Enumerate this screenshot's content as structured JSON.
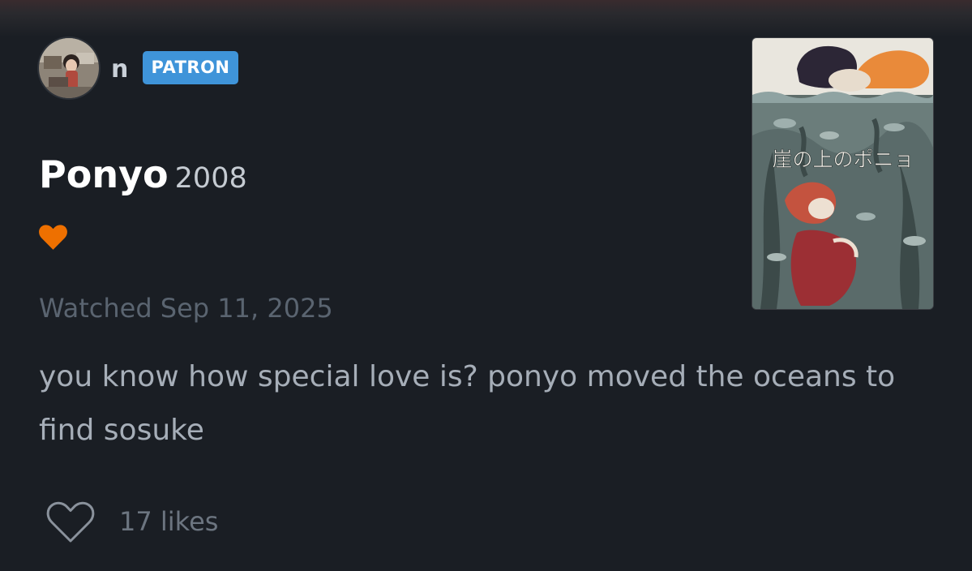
{
  "user": {
    "name": "n",
    "badge": "PATRON",
    "avatar": "user-avatar-photo"
  },
  "film": {
    "title": "Ponyo",
    "year": "2008",
    "poster": "ponyo-poster",
    "poster_text": "崖の上のポニョ"
  },
  "review": {
    "liked": true,
    "like_icon": "heart-filled-icon",
    "like_color": "#ee7000",
    "watched_date": "Watched Sep 11, 2025",
    "body": "you know how special love is? ponyo moved the oceans to find sosuke"
  },
  "footer": {
    "like_button_icon": "heart-outline-icon",
    "likes": "17 likes"
  },
  "colors": {
    "background": "#1a1e24",
    "badge": "#3f94d9",
    "title": "#ffffff"
  }
}
